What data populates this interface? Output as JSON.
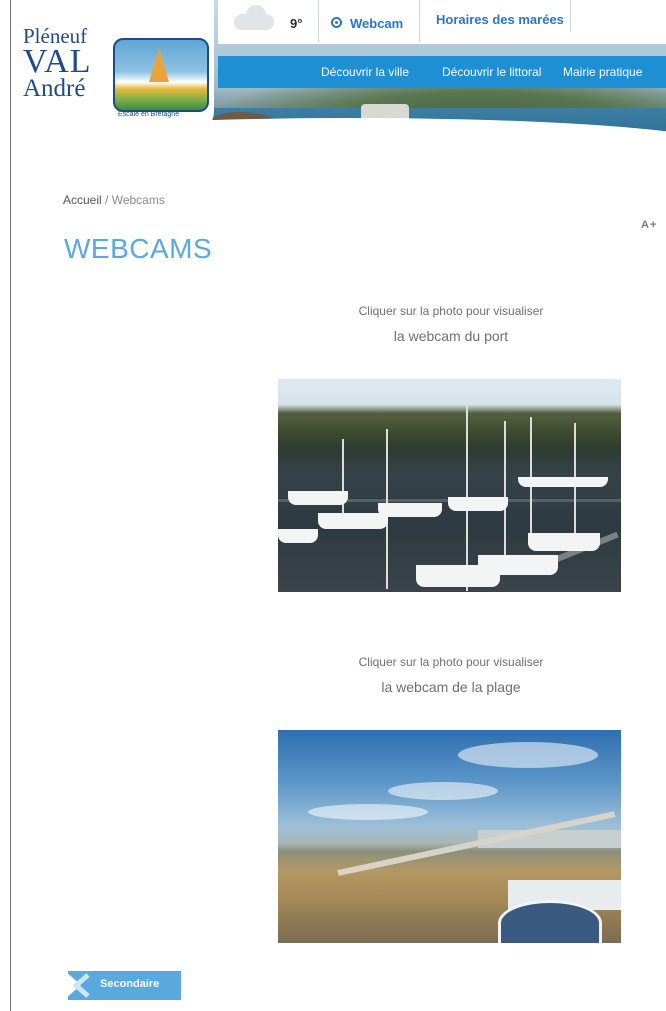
{
  "logo": {
    "line1": "Pléneuf",
    "line2": "VAL",
    "line3": "André",
    "tagline": "Escale en Bretagne"
  },
  "topbar": {
    "weather_icon": "cloud-icon",
    "temperature": "9°",
    "webcam_label": "Webcam",
    "webcam_icon": "webcam-icon",
    "tides_label": "Horaires des marées"
  },
  "nav": {
    "items": [
      {
        "label": "Découvrir la ville"
      },
      {
        "label": "Découvrir le littoral"
      },
      {
        "label": "Mairie pratique"
      }
    ]
  },
  "breadcrumb": {
    "home": "Accueil",
    "separator": " / ",
    "current": "Webcams"
  },
  "font_size_control": "A+",
  "page_title": "WEBCAMS",
  "webcams": [
    {
      "caption_line1": "Cliquer sur la photo pour visualiser",
      "caption_line2": "la webcam du port"
    },
    {
      "caption_line1": "Cliquer sur la photo pour visualiser",
      "caption_line2": "la webcam de la plage"
    }
  ],
  "secondary_button": {
    "label": "Secondaire",
    "icon": "chevron-left-icon"
  },
  "colors": {
    "accent": "#5aa9de",
    "nav_blue": "#1f8fd3",
    "link_blue": "#2a77c0",
    "logo_blue": "#1d4c86"
  }
}
